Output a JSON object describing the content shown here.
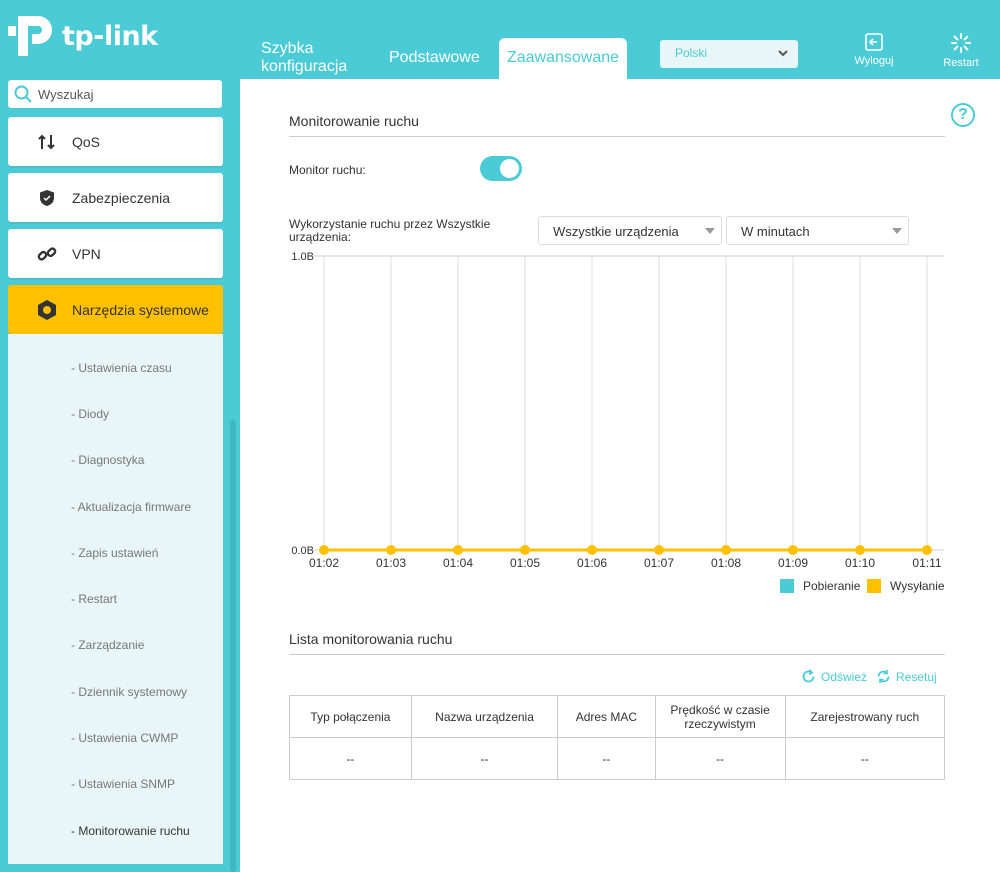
{
  "brand": {
    "logo_text": "tp-link",
    "accent": "#4acbd6",
    "active": "#ffc000"
  },
  "header": {
    "tabs": [
      {
        "label": "Szybka konfiguracja"
      },
      {
        "label": "Podstawowe"
      },
      {
        "label": "Zaawansowane",
        "active": true
      }
    ],
    "language": "Polski",
    "logout_label": "Wyloguj",
    "restart_label": "Restart"
  },
  "sidebar": {
    "search_placeholder": "Wyszukaj",
    "items": [
      {
        "label": "QoS",
        "icon": "updown-arrows-icon"
      },
      {
        "label": "Zabezpieczenia",
        "icon": "shield-icon"
      },
      {
        "label": "VPN",
        "icon": "link-icon"
      },
      {
        "label": "Narzędzia systemowe",
        "icon": "gear-icon",
        "active": true
      }
    ],
    "submenu": [
      "- Ustawienia czasu",
      "- Diody",
      "- Diagnostyka",
      "- Aktualizacja firmware",
      "- Zapis ustawień",
      "- Restart",
      "- Zarządzanie",
      "- Dziennik systemowy",
      "- Ustawienia CWMP",
      "- Ustawienia SNMP",
      "- Monitorowanie ruchu"
    ]
  },
  "main": {
    "title": "Monitorowanie ruchu",
    "monitor_label": "Monitor ruchu:",
    "monitor_on": true,
    "usage_label": "Wykorzystanie ruchu przez Wszystkie urządzenia:",
    "device_select": "Wszystkie urządzenia",
    "interval_select": "W minutach",
    "legend": {
      "download": "Pobieranie",
      "upload": "Wysyłanie"
    },
    "list_title": "Lista monitorowania ruchu",
    "refresh_label": "Odśwież",
    "reset_label": "Resetuj",
    "table": {
      "headers": [
        "Typ połączenia",
        "Nazwa urządzenia",
        "Adres MAC",
        "Prędkość w czasie rzeczywistym",
        "Zarejestrowany ruch"
      ],
      "rows": [
        [
          "--",
          "--",
          "--",
          "--",
          "--"
        ]
      ]
    }
  },
  "chart_data": {
    "type": "line",
    "categories": [
      "01:02",
      "01:03",
      "01:04",
      "01:05",
      "01:06",
      "01:07",
      "01:08",
      "01:09",
      "01:10",
      "01:11"
    ],
    "series": [
      {
        "name": "Pobieranie",
        "color": "#4acbd6",
        "values": [
          0,
          0,
          0,
          0,
          0,
          0,
          0,
          0,
          0,
          0
        ]
      },
      {
        "name": "Wysyłanie",
        "color": "#ffc000",
        "values": [
          0,
          0,
          0,
          0,
          0,
          0,
          0,
          0,
          0,
          0
        ]
      }
    ],
    "y_ticks": [
      "1.0B",
      "0.0B"
    ],
    "ylim": [
      0,
      1
    ],
    "grid": true,
    "legend": "bottom-right"
  }
}
